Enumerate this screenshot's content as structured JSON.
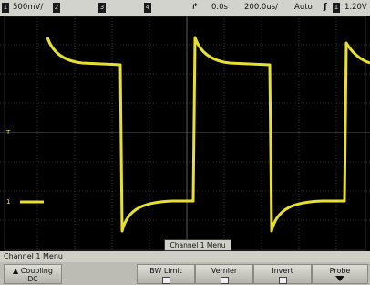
{
  "status": {
    "channel_number": "1",
    "volts_per_div": "500mV/",
    "ch2_label": "2",
    "ch3_label": "3",
    "ch4_label": "4",
    "time_delay": "0.0s",
    "time_per_div": "200.0us/",
    "trigger_mode": "Auto",
    "trigger_channel": "1",
    "trigger_level": "1.20V"
  },
  "markers": {
    "trigger_level_marker": "T",
    "ground_marker": "1"
  },
  "menu": {
    "title": "Channel 1  Menu",
    "popup": "Channel 1  Menu",
    "softkeys": [
      {
        "label": "Coupling",
        "value": "DC"
      },
      {
        "label": "BW Limit"
      },
      {
        "label": "Vernier"
      },
      {
        "label": "Invert"
      },
      {
        "label": "Probe"
      }
    ]
  },
  "colors": {
    "trace": "#e8e030",
    "grid": "#3c3c3c"
  }
}
